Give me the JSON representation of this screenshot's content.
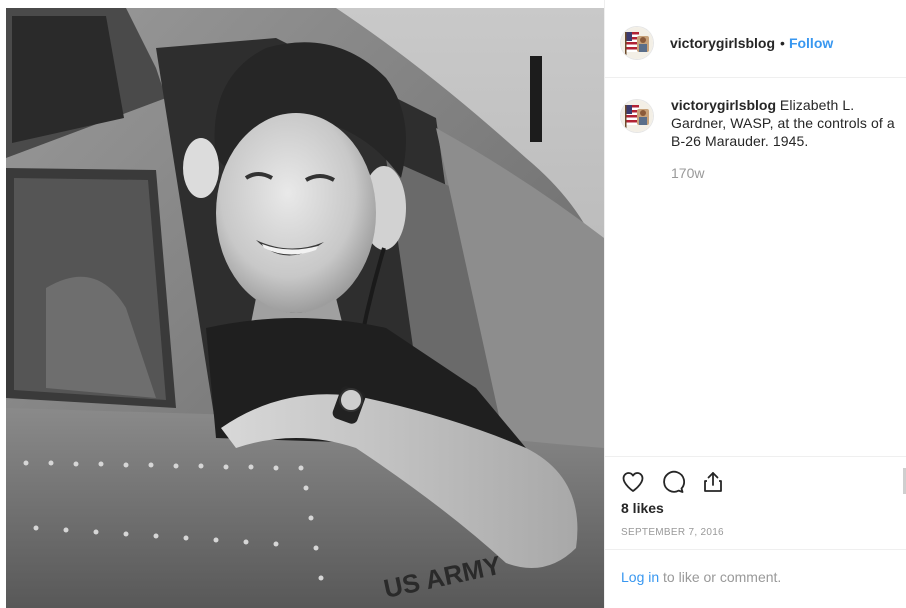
{
  "post": {
    "username": "victorygirlsblog",
    "header_separator": "•",
    "follow_label": "Follow",
    "caption": "Elizabeth L. Gardner, WASP, at the controls of a B-26 Marauder. 1945.",
    "comment_time": "170w",
    "likes": "8 likes",
    "date": "SEPTEMBER 7, 2016",
    "photo_markings": "US ARMY",
    "login_link": "Log in",
    "login_suffix": " to like or comment."
  },
  "colors": {
    "link_blue": "#3897f0",
    "text_dark": "#262626",
    "text_muted": "#999999",
    "divider": "#efefef"
  },
  "icons": {
    "like": "heart-outline-icon",
    "comment": "speech-bubble-icon",
    "share": "share-upload-icon"
  }
}
